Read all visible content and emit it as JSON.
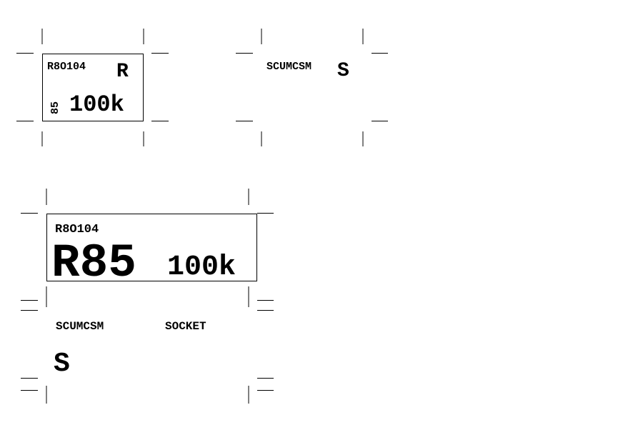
{
  "small_label": {
    "part_number": "R8O104",
    "designator_letter": "R",
    "designator_number": "85",
    "value": "100k"
  },
  "small_socket_label": {
    "part_number": "SCUMCSM",
    "designator_letter": "S"
  },
  "large_label": {
    "part_number": "R8O104",
    "designator": "R85",
    "value": "100k"
  },
  "large_socket_label": {
    "part_number": "SCUMCSM",
    "type": "SOCKET",
    "designator_letter": "S"
  },
  "colors": {
    "ink": "#000000",
    "background": "#ffffff"
  }
}
